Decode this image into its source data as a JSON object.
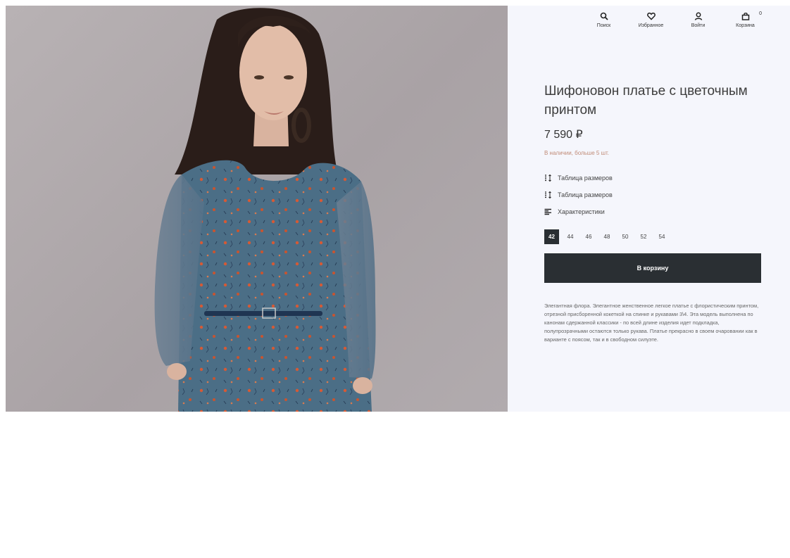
{
  "nav": {
    "search_label": "Поиск",
    "favorites_label": "Избранное",
    "login_label": "Войти",
    "cart_label": "Корзина",
    "cart_count": "0"
  },
  "product": {
    "title": "Шифоновон платье с цветочным принтом",
    "price": "7 590 ₽",
    "stock": "В наличии, больше 5 шт.",
    "links": [
      {
        "label": "Таблица размеров",
        "icon": "size-table-icon"
      },
      {
        "label": "Таблица размеров",
        "icon": "size-table-icon"
      },
      {
        "label": "Характеристики",
        "icon": "characteristics-icon"
      }
    ],
    "sizes": [
      "42",
      "44",
      "46",
      "48",
      "50",
      "52",
      "54"
    ],
    "selected_size": "42",
    "add_to_cart_label": "В корзину",
    "description": "Элегантная флора. Элегантное женственное легкое платье с флористическим принтом, отрезной присборенной кокеткой на спинке и рукавами 3\\4. Эта модель выполнена по канонам сдержанной классики - по всей длине изделия идет подкладка, полупрозрачными остаются только рукава. Платье прекрасно в своем очаровании как в варианте с поясом, так и в свободном силуэте."
  },
  "colors": {
    "panel_bg": "#f5f6fc",
    "button_bg": "#2a2f33",
    "stock_text": "#c08a76",
    "dress": "#4a6f88"
  }
}
